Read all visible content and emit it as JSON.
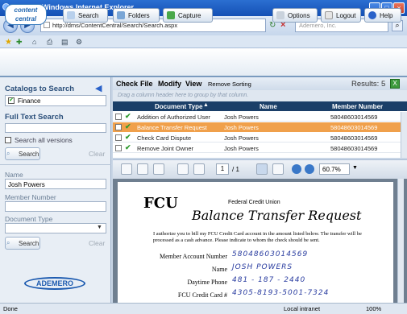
{
  "browser": {
    "title": "Search - Windows Internet Explorer",
    "address": "http://dms/ContentCentral/Search/Search.aspx",
    "search_placeholder": "Ademero, Inc.",
    "status_left": "Done",
    "zone": "Local intranet",
    "zoom": "100%"
  },
  "header": {
    "logo_line1": "content",
    "logo_line2": "central",
    "search": "Search",
    "folders": "Folders",
    "capture": "Capture",
    "options": "Options",
    "logout": "Logout",
    "help": "Help"
  },
  "sidebar": {
    "catalogs_title": "Catalogs to Search",
    "catalog_item": "Finance",
    "fulltext_title": "Full Text Search",
    "search_all_versions": "Search all versions",
    "search_btn": "Search",
    "clear": "Clear",
    "name_label": "Name",
    "name_value": "Josh Powers",
    "member_label": "Member Number",
    "doctype_label": "Document Type",
    "search_btn2": "Search",
    "clear2": "Clear",
    "brand": "ADEMERO"
  },
  "grid": {
    "menu": [
      "Check",
      "File",
      "Modify",
      "View"
    ],
    "remove_sorting": "Remove Sorting",
    "results": "Results: 5",
    "group_hint": "Drag a column header here to group by that column.",
    "columns": [
      "Document Type",
      "Name",
      "Member Number"
    ],
    "rows": [
      {
        "type": "Addition of Authorized User",
        "name": "Josh Powers",
        "member": "58048603014569"
      },
      {
        "type": "Balance Transfer Request",
        "name": "Josh Powers",
        "member": "58048603014569"
      },
      {
        "type": "Check Card Dispute",
        "name": "Josh Powers",
        "member": "58048603014569"
      },
      {
        "type": "Remove Joint Owner",
        "name": "Josh Powers",
        "member": "58048603014569"
      }
    ]
  },
  "viewer": {
    "page_num": "1",
    "page_total": "/ 1",
    "zoom": "60.7%"
  },
  "document": {
    "org": "Federal Credit Union",
    "logo": "FCU",
    "title": "Balance Transfer Request",
    "body": "I authorize you to bill my FCU Credit Card account in the amount listed below. The transfer will be processed as a cash advance. Please indicate to whom the check should be sent.",
    "fields": [
      {
        "label": "Member Account Number",
        "value": "58048603014569"
      },
      {
        "label": "Name",
        "value": "JOSH POWERS"
      },
      {
        "label": "Daytime Phone",
        "value": "481 - 187 - 2440"
      },
      {
        "label": "FCU Credit Card #",
        "value": "4305-8193-5001-7324"
      }
    ]
  },
  "colors": {
    "selected_row": "#f0a04b",
    "header_dark": "#1b3f68"
  }
}
